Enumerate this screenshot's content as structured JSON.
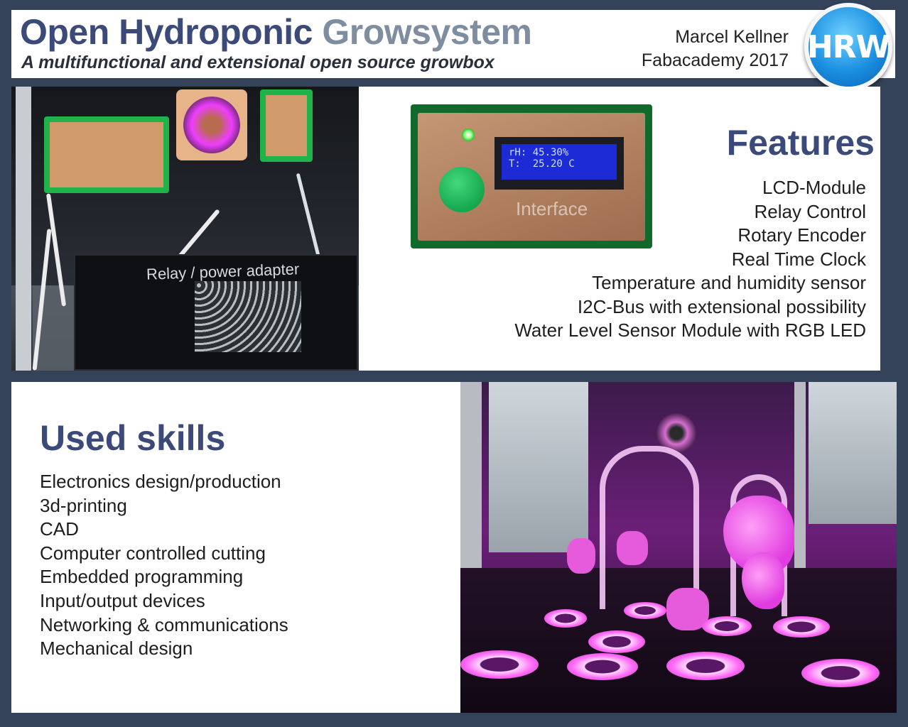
{
  "header": {
    "title_part1": "Open Hydroponic",
    "title_part2": "Growsystem",
    "subtitle": "A multifunctional and extensional open source growbox",
    "author": "Marcel Kellner",
    "event": "Fabacademy 2017",
    "logo_text": "HRW"
  },
  "photos": {
    "electronics_label": "Relay / power adapter",
    "interface_label": "Interface",
    "lcd_line1": "rH: 45.30%",
    "lcd_line2": "T:  25.20 C"
  },
  "features": {
    "title": "Features",
    "items": [
      "LCD-Module",
      "Relay Control",
      "Rotary Encoder",
      "Real Time Clock",
      "Temperature and humidity sensor",
      "I2C-Bus with extensional possibility",
      "Water Level Sensor Module with RGB LED"
    ]
  },
  "skills": {
    "title": "Used skills",
    "items": [
      "Electronics design/production",
      "3d-printing",
      "CAD",
      "Computer controlled cutting",
      "Embedded programming",
      "Input/output devices",
      "Networking & communications",
      "Mechanical design"
    ]
  },
  "colors": {
    "background": "#34425a",
    "title_primary": "#3b4a79",
    "title_secondary": "#7e8da0",
    "logo_blue": "#1a8fe0"
  }
}
